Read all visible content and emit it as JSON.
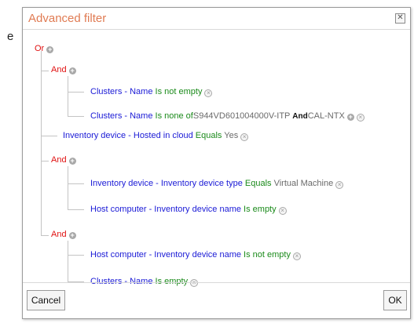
{
  "background_fragment": "e",
  "dialog": {
    "title": "Advanced filter",
    "close_glyph": "✕",
    "plus_glyph": "+",
    "delete_glyph": "×",
    "tree": {
      "root_op": "Or",
      "group1": {
        "op": "And",
        "c1": {
          "field": "Clusters - Name",
          "cmp": "Is not empty"
        },
        "c2": {
          "field": "Clusters - Name",
          "cmp": "Is none of",
          "v1": "S944VD601004000V-ITP",
          "conj": "And",
          "v2": "CAL-NTX"
        }
      },
      "c3": {
        "field": "Inventory device - Hosted in cloud",
        "cmp": "Equals",
        "val": "Yes"
      },
      "group2": {
        "op": "And",
        "c1": {
          "field": "Inventory device - Inventory device type",
          "cmp": "Equals",
          "val": "Virtual Machine"
        },
        "c2": {
          "field": "Host computer - Inventory device name",
          "cmp": "Is empty"
        }
      },
      "group3": {
        "op": "And",
        "c1": {
          "field": "Host computer - Inventory device name",
          "cmp": "Is not empty"
        },
        "c2": {
          "field": "Clusters - Name",
          "cmp": "Is empty"
        }
      }
    },
    "buttons": {
      "cancel": "Cancel",
      "ok": "OK"
    }
  }
}
